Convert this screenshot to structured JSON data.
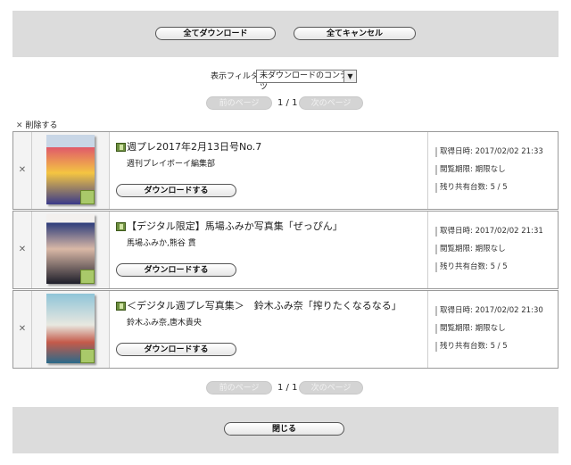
{
  "toolbar": {
    "download_all": "全てダウンロード",
    "cancel_all": "全てキャンセル"
  },
  "filter": {
    "label": "表示フィルタ:",
    "selected": "未ダウンロードのコンテンツ",
    "arrow": "▼"
  },
  "pager": {
    "prev": "前のページ",
    "next": "次のページ",
    "current": "1 / 1"
  },
  "delete_all": {
    "icon": "✕",
    "label": "削除する"
  },
  "items": [
    {
      "delete_icon": "✕",
      "title": "週プレ2017年2月13日号No.7",
      "author": "週刊プレイボーイ編集部",
      "download_label": "ダウンロードする",
      "acquired": "取得日時: 2017/02/02 21:33",
      "view_limit": "閲覧期限: 期限なし",
      "shared_left": "残り共有台数: 5 / 5",
      "cover_colors": [
        "#c8d6e6",
        "#e05a6a",
        "#f4c542",
        "#3a3a8a"
      ]
    },
    {
      "delete_icon": "✕",
      "title": "【デジタル限定】馬場ふみか写真集「ぜっぴん」",
      "author": "馬場ふみか,熊谷 貫",
      "download_label": "ダウンロードする",
      "acquired": "取得日時: 2017/02/02 21:31",
      "view_limit": "閲覧期限: 期限なし",
      "shared_left": "残り共有台数: 5 / 5",
      "cover_colors": [
        "#f3f0ee",
        "#2b3b7a",
        "#d9b8a6",
        "#1e1e2a"
      ]
    },
    {
      "delete_icon": "✕",
      "title": "＜デジタル週プレ写真集＞　鈴木ふみ奈「搾りたくなるなる」",
      "author": "鈴木ふみ奈,唐木貴央",
      "download_label": "ダウンロードする",
      "acquired": "取得日時: 2017/02/02 21:30",
      "view_limit": "閲覧期限: 期限なし",
      "shared_left": "残り共有台数: 5 / 5",
      "cover_colors": [
        "#8fc4d8",
        "#e8e8e0",
        "#c45a4a",
        "#2a6a8a"
      ]
    }
  ],
  "footer": {
    "close": "閉じる"
  }
}
